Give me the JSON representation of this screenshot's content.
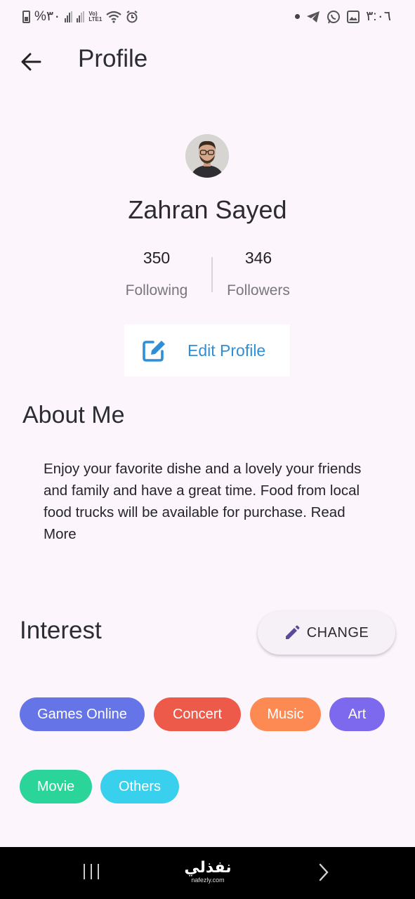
{
  "status_bar": {
    "battery_text": "%٣٠",
    "lte_label_1": "Vo)",
    "lte_label_2": "LTE1",
    "time": "٣:٠٦"
  },
  "header": {
    "title": "Profile",
    "back_icon": "arrow-left-icon"
  },
  "profile": {
    "name": "Zahran Sayed",
    "following_count": "350",
    "following_label": "Following",
    "followers_count": "346",
    "followers_label": "Followers",
    "edit_label": "Edit Profile",
    "edit_icon": "edit-square-icon"
  },
  "about": {
    "title": "About Me",
    "text": "Enjoy your favorite dishe and a lovely your friends and family and have a great time. Food from local food trucks will be available for purchase. Read More"
  },
  "interest": {
    "title": "Interest",
    "change_label": "CHANGE",
    "change_icon": "pencil-icon",
    "chips": [
      {
        "label": "Games Online",
        "color": "#6574e6"
      },
      {
        "label": "Concert",
        "color": "#ee5a4a"
      },
      {
        "label": "Music",
        "color": "#fd8a52"
      },
      {
        "label": "Art",
        "color": "#7c69ee"
      },
      {
        "label": "Movie",
        "color": "#2bd59a"
      },
      {
        "label": "Others",
        "color": "#39d0ee"
      }
    ]
  },
  "watermark": {
    "main": "نفذلي",
    "sub": "nafezly.com"
  },
  "colors": {
    "background": "#fcf5fc",
    "accent": "#2f8fd6",
    "nav_bar": "#000000"
  }
}
